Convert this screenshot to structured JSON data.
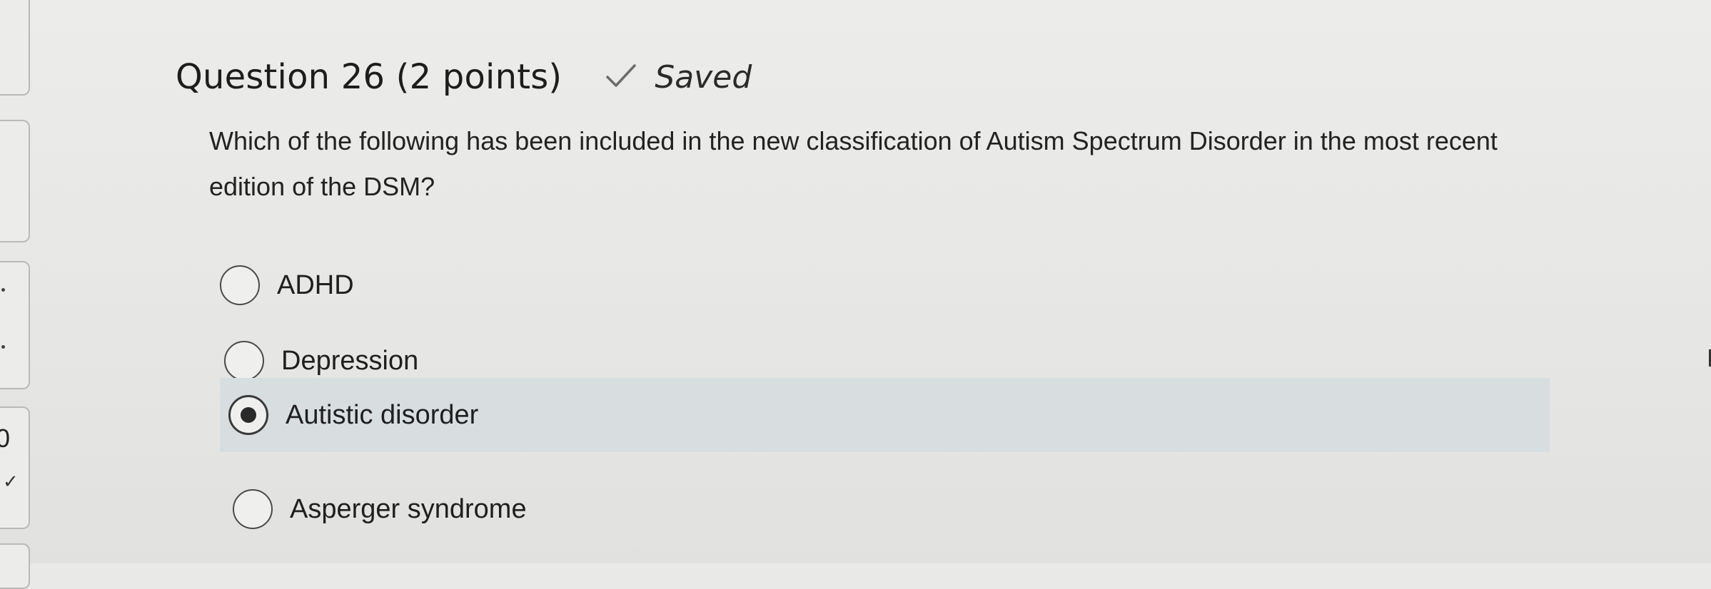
{
  "question": {
    "title": "Question 26 (2 points)",
    "status": "Saved",
    "prompt": "Which of the following has been included in the new classification of Autism Spectrum Disorder in the most recent edition of the DSM?"
  },
  "options": [
    {
      "label": "ADHD",
      "selected": false
    },
    {
      "label": "Depression",
      "selected": false
    },
    {
      "label": "Autistic disorder",
      "selected": true
    },
    {
      "label": "Asperger syndrome",
      "selected": false
    }
  ],
  "nav": {
    "visible_number": "0"
  },
  "colors": {
    "selected_row": "#d8dde0",
    "background": "#e9e9e7"
  }
}
